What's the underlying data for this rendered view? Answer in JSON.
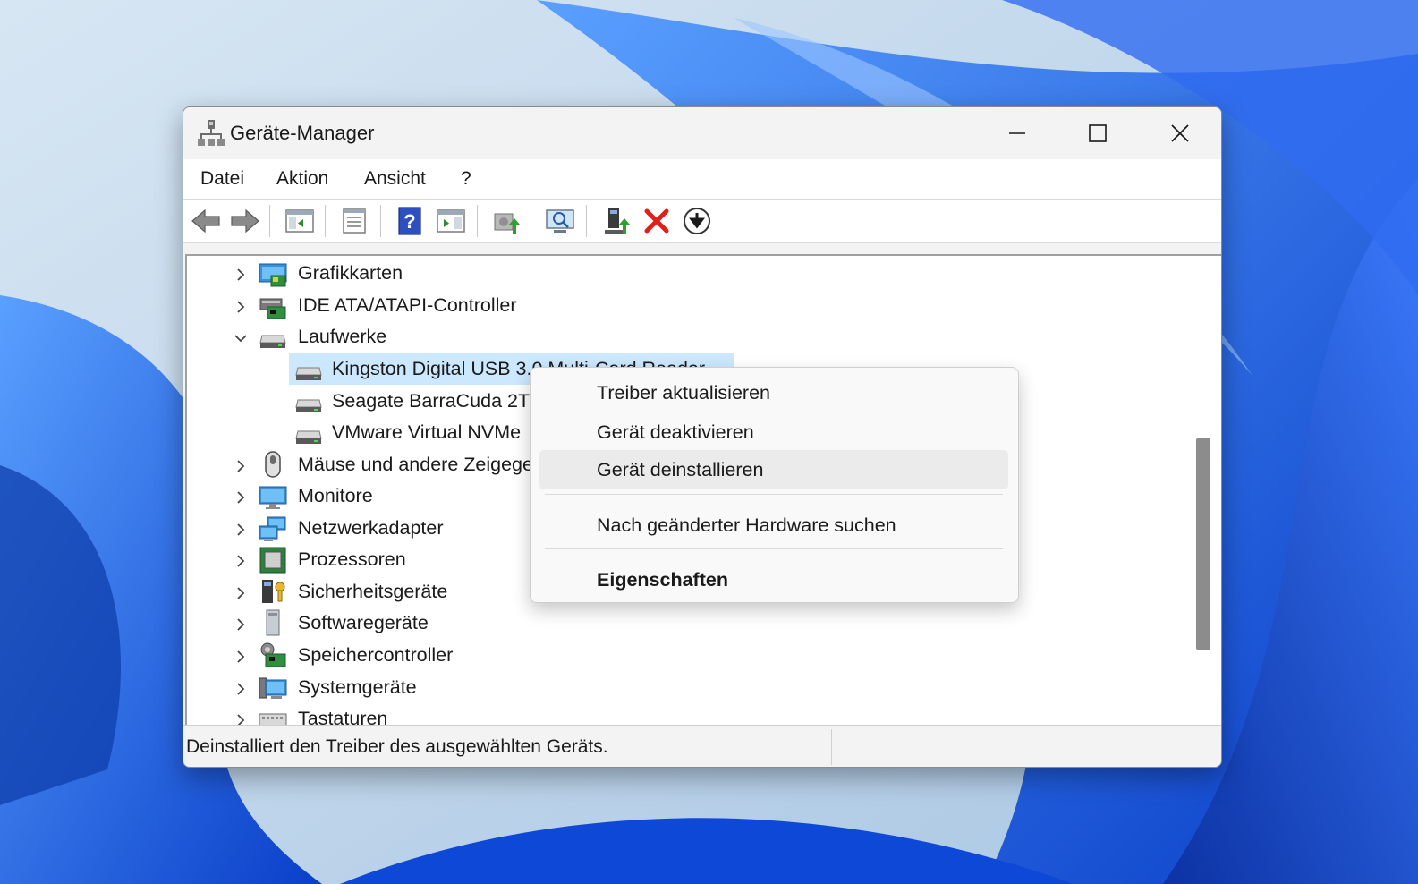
{
  "window": {
    "title": "Geräte-Manager"
  },
  "menubar": {
    "items": [
      "Datei",
      "Aktion",
      "Ansicht",
      "?"
    ]
  },
  "toolbar": {
    "buttons": [
      "back-icon",
      "forward-icon",
      "console-tree-icon",
      "properties-icon",
      "help-icon",
      "action-pane-icon",
      "update-driver-icon",
      "scan-hardware-icon",
      "enable-device-icon",
      "uninstall-icon",
      "disable-device-icon"
    ]
  },
  "tree": {
    "items": [
      {
        "label": "Grafikkarten",
        "icon": "display-adapter-icon",
        "expanded": false
      },
      {
        "label": "IDE ATA/ATAPI-Controller",
        "icon": "ide-controller-icon",
        "expanded": false
      },
      {
        "label": "Laufwerke",
        "icon": "disk-drive-icon",
        "expanded": true
      },
      {
        "label": "Kingston Digital USB 3.0 Multi-Card Reader",
        "icon": "disk-drive-icon",
        "child": true,
        "selected": true
      },
      {
        "label": "Seagate BarraCuda 2TB",
        "icon": "disk-drive-icon",
        "child": true
      },
      {
        "label": "VMware Virtual NVMe",
        "icon": "disk-drive-icon",
        "child": true
      },
      {
        "label": "Mäuse und andere Zeigegeräte",
        "icon": "mouse-icon",
        "expanded": false
      },
      {
        "label": "Monitore",
        "icon": "monitor-icon",
        "expanded": false
      },
      {
        "label": "Netzwerkadapter",
        "icon": "network-adapter-icon",
        "expanded": false
      },
      {
        "label": "Prozessoren",
        "icon": "processor-icon",
        "expanded": false
      },
      {
        "label": "Sicherheitsgeräte",
        "icon": "security-device-icon",
        "expanded": false
      },
      {
        "label": "Softwaregeräte",
        "icon": "software-device-icon",
        "expanded": false
      },
      {
        "label": "Speichercontroller",
        "icon": "storage-controller-icon",
        "expanded": false
      },
      {
        "label": "Systemgeräte",
        "icon": "system-device-icon",
        "expanded": false
      },
      {
        "label": "Tastaturen",
        "icon": "keyboard-icon",
        "expanded": false
      }
    ]
  },
  "context_menu": {
    "items": [
      "Treiber aktualisieren",
      "Gerät deaktivieren",
      "Gerät deinstallieren",
      "Nach geänderter Hardware suchen",
      "Eigenschaften"
    ],
    "hovered": "Gerät deinstallieren"
  },
  "status": {
    "text": "Deinstalliert den Treiber des ausgewählten Geräts."
  },
  "colors": {
    "selection": "#cce8ff",
    "wallpaper_blue": "#1a5ce0",
    "uninstall_red": "#e0201a"
  }
}
